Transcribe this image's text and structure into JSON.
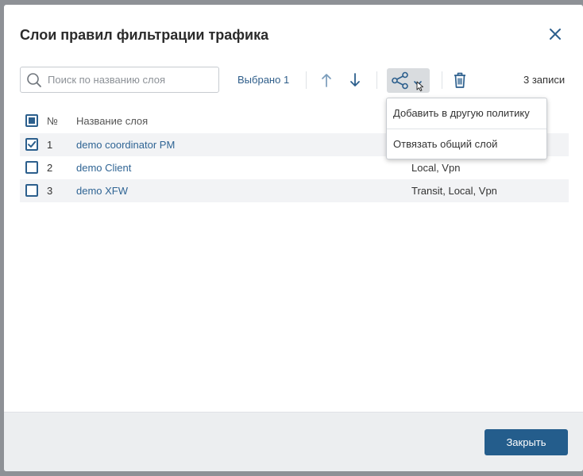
{
  "dialog": {
    "title": "Слои правил фильтрации трафика",
    "close_button": "close-icon"
  },
  "toolbar": {
    "search_placeholder": "Поиск по названию слоя",
    "search_value": "",
    "selected_label": "Выбрано 1",
    "move_up_icon": "arrow-up-icon",
    "move_down_icon": "arrow-down-icon",
    "share_icon": "share-icon",
    "delete_icon": "trash-icon",
    "records_count": "3 записи"
  },
  "table": {
    "header": {
      "no": "№",
      "name": "Название слоя"
    },
    "rows": [
      {
        "no": "1",
        "name": "demo coordinator PM",
        "direction": "",
        "checked": true
      },
      {
        "no": "2",
        "name": "demo Client",
        "direction": "Local, Vpn",
        "checked": false
      },
      {
        "no": "3",
        "name": "demo XFW",
        "direction": "Transit, Local, Vpn",
        "checked": false
      }
    ]
  },
  "share_menu": {
    "items": [
      "Добавить в другую политику",
      "Отвязать общий слой"
    ]
  },
  "footer": {
    "close_button": "Закрыть"
  },
  "colors": {
    "primary": "#245d8c",
    "link": "#2f6494",
    "overlay": "#8e9196",
    "footer_bg": "#eceef0",
    "row_stripe": "#f2f3f5"
  }
}
